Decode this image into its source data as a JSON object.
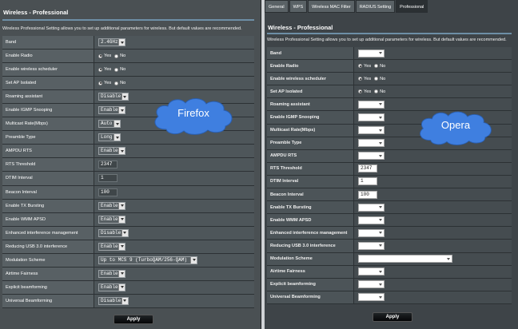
{
  "left": {
    "title": "Wireless - Professional",
    "description": "Wireless Professional Setting allows you to set up additional parameters for wireless. But default values are recommended.",
    "rows": [
      {
        "label": "Band",
        "type": "select",
        "value": "2.4GHz"
      },
      {
        "label": "Enable Radio",
        "type": "radio",
        "yes": "Yes",
        "no": "No",
        "selected": "yes"
      },
      {
        "label": "Enable wireless scheduler",
        "type": "radio",
        "yes": "Yes",
        "no": "No",
        "selected": "yes"
      },
      {
        "label": "Set AP Isolated",
        "type": "radio",
        "yes": "Yes",
        "no": "No",
        "selected": "yes"
      },
      {
        "label": "Roaming assistant",
        "type": "select",
        "value": "Disable"
      },
      {
        "label": "Enable IGMP Snooping",
        "type": "select",
        "value": "Enable"
      },
      {
        "label": "Multicast Rate(Mbps)",
        "type": "select",
        "value": "Auto"
      },
      {
        "label": "Preamble Type",
        "type": "select",
        "value": "Long"
      },
      {
        "label": "AMPDU RTS",
        "type": "select",
        "value": "Enable"
      },
      {
        "label": "RTS Threshold",
        "type": "text",
        "value": "2347"
      },
      {
        "label": "DTIM Interval",
        "type": "text",
        "value": "1"
      },
      {
        "label": "Beacon Interval",
        "type": "text",
        "value": "100"
      },
      {
        "label": "Enable TX Bursting",
        "type": "select",
        "value": "Enable"
      },
      {
        "label": "Enable WMM APSD",
        "type": "select",
        "value": "Enable"
      },
      {
        "label": "Enhanced interference management",
        "type": "select",
        "value": "Disable"
      },
      {
        "label": "Reducing USB 3.0 interference",
        "type": "select",
        "value": "Enable"
      },
      {
        "label": "Modulation Scheme",
        "type": "select",
        "value": "Up to MCS 9 (TurboQAM/256-QAM)"
      },
      {
        "label": "Airtime Fairness",
        "type": "select",
        "value": "Enable"
      },
      {
        "label": "Explicit beamforming",
        "type": "select",
        "value": "Enable"
      },
      {
        "label": "Universal Beamforming",
        "type": "select",
        "value": "Disable"
      }
    ],
    "apply_label": "Apply",
    "browser_label": "Firefox"
  },
  "right": {
    "tabs": [
      {
        "label": "General",
        "active": false
      },
      {
        "label": "WPS",
        "active": false
      },
      {
        "label": "Wireless MAC Filter",
        "active": false
      },
      {
        "label": "RADIUS Setting",
        "active": false
      },
      {
        "label": "Professional",
        "active": true
      }
    ],
    "title": "Wireless - Professional",
    "description": "Wireless Professional Setting allows you to set up additional parameters for wireless. But default values are recommended.",
    "rows": [
      {
        "label": "Band",
        "type": "select",
        "value": ""
      },
      {
        "label": "Enable Radio",
        "type": "radio",
        "yes": "Yes",
        "no": "No",
        "selected": "yes"
      },
      {
        "label": "Enable wireless scheduler",
        "type": "radio",
        "yes": "Yes",
        "no": "No",
        "selected": "yes"
      },
      {
        "label": "Set AP Isolated",
        "type": "radio",
        "yes": "Yes",
        "no": "No",
        "selected": "yes"
      },
      {
        "label": "Roaming assistant",
        "type": "select",
        "value": ""
      },
      {
        "label": "Enable IGMP Snooping",
        "type": "select",
        "value": ""
      },
      {
        "label": "Multicast Rate(Mbps)",
        "type": "select",
        "value": ""
      },
      {
        "label": "Preamble Type",
        "type": "select",
        "value": ""
      },
      {
        "label": "AMPDU RTS",
        "type": "select",
        "value": ""
      },
      {
        "label": "RTS Threshold",
        "type": "text",
        "value": "2347"
      },
      {
        "label": "DTIM Interval",
        "type": "text",
        "value": "1"
      },
      {
        "label": "Beacon Interval",
        "type": "text",
        "value": "100"
      },
      {
        "label": "Enable TX Bursting",
        "type": "select",
        "value": ""
      },
      {
        "label": "Enable WMM APSD",
        "type": "select",
        "value": ""
      },
      {
        "label": "Enhanced interference management",
        "type": "select",
        "value": ""
      },
      {
        "label": "Reducing USB 3.0 interference",
        "type": "select",
        "value": ""
      },
      {
        "label": "Modulation Scheme",
        "type": "select",
        "value": ""
      },
      {
        "label": "Airtime Fairness",
        "type": "select",
        "value": ""
      },
      {
        "label": "Explicit beamforming",
        "type": "select",
        "value": ""
      },
      {
        "label": "Universal Beamforming",
        "type": "select",
        "value": ""
      }
    ],
    "apply_label": "Apply",
    "browser_label": "Opera"
  },
  "colors": {
    "cloud_fill": "#3f7fe0",
    "accent_rule": "#6d8fa6"
  }
}
